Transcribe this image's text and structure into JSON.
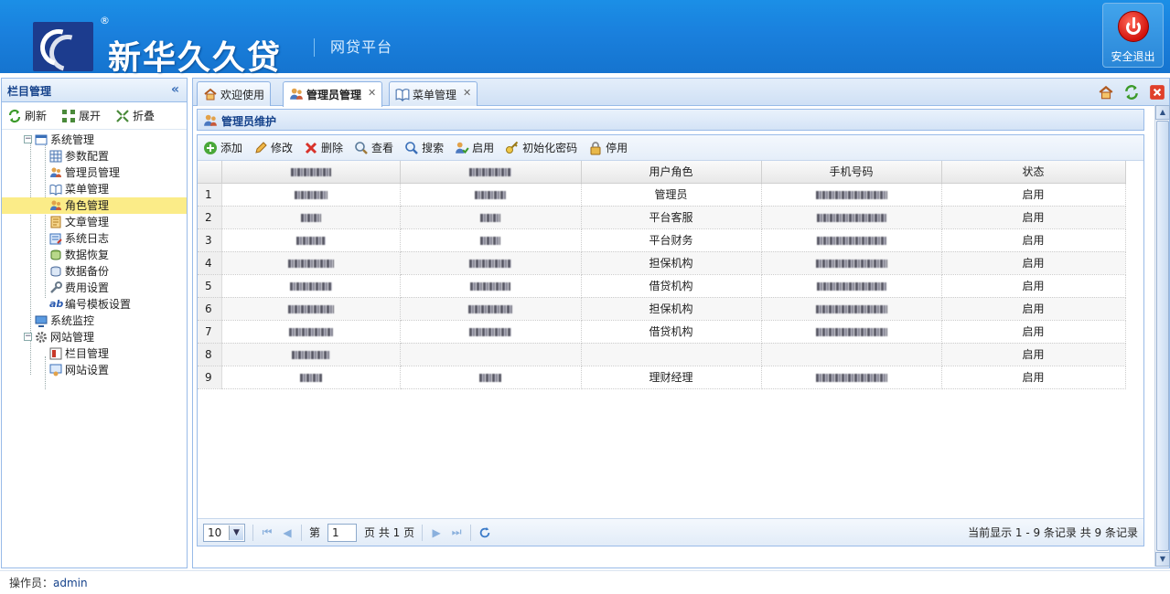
{
  "header": {
    "brand": "新华久久贷",
    "registered_mark": "®",
    "subtitle": "网贷平台",
    "logout_label": "安全退出"
  },
  "sidebar": {
    "title": "栏目管理",
    "toolbar": {
      "refresh": "刷新",
      "expand": "展开",
      "collapse": "折叠"
    },
    "tree": [
      {
        "label": "系统管理",
        "icon": "window-icon",
        "level": 0,
        "expanded": true
      },
      {
        "label": "参数配置",
        "icon": "grid-icon",
        "level": 1
      },
      {
        "label": "管理员管理",
        "icon": "users-icon",
        "level": 1
      },
      {
        "label": "菜单管理",
        "icon": "book-icon",
        "level": 1
      },
      {
        "label": "角色管理",
        "icon": "users-icon",
        "level": 1,
        "selected": true
      },
      {
        "label": "文章管理",
        "icon": "document-icon",
        "level": 1
      },
      {
        "label": "系统日志",
        "icon": "log-icon",
        "level": 1
      },
      {
        "label": "数据恢复",
        "icon": "restore-icon",
        "level": 1
      },
      {
        "label": "数据备份",
        "icon": "backup-icon",
        "level": 1
      },
      {
        "label": "费用设置",
        "icon": "wrench-icon",
        "level": 1
      },
      {
        "label": "编号模板设置",
        "icon": "ab-icon",
        "level": 1
      },
      {
        "label": "系统监控",
        "icon": "monitor-icon",
        "level": 0
      },
      {
        "label": "网站管理",
        "icon": "gear-icon",
        "level": 0,
        "expanded": true
      },
      {
        "label": "栏目管理",
        "icon": "columns-icon",
        "level": 1
      },
      {
        "label": "网站设置",
        "icon": "site-settings-icon",
        "level": 1
      }
    ]
  },
  "tabs": [
    {
      "label": "欢迎使用",
      "icon": "home-icon",
      "closable": false,
      "active": false
    },
    {
      "label": "管理员管理",
      "icon": "users-icon",
      "closable": true,
      "active": true
    },
    {
      "label": "菜单管理",
      "icon": "book-icon",
      "closable": true,
      "active": false
    }
  ],
  "tab_tools": [
    "home-icon",
    "refresh-icon",
    "close-icon"
  ],
  "panel": {
    "title": "管理员维护",
    "toolbar": [
      {
        "label": "添加",
        "icon": "add-icon"
      },
      {
        "label": "修改",
        "icon": "edit-icon"
      },
      {
        "label": "删除",
        "icon": "delete-icon"
      },
      {
        "label": "查看",
        "icon": "view-icon"
      },
      {
        "label": "搜索",
        "icon": "search-icon"
      },
      {
        "label": "启用",
        "icon": "enable-icon"
      },
      {
        "label": "初始化密码",
        "icon": "key-icon"
      },
      {
        "label": "停用",
        "icon": "lock-icon"
      }
    ],
    "columns": [
      "",
      "",
      "用户角色",
      "手机号码",
      "状态"
    ],
    "rows": [
      {
        "no": "1",
        "role": "管理员",
        "status": "启用"
      },
      {
        "no": "2",
        "role": "平台客服",
        "status": "启用"
      },
      {
        "no": "3",
        "role": "平台财务",
        "status": "启用"
      },
      {
        "no": "4",
        "role": "担保机构",
        "status": "启用"
      },
      {
        "no": "5",
        "role": "借贷机构",
        "status": "启用"
      },
      {
        "no": "6",
        "role": "担保机构",
        "status": "启用"
      },
      {
        "no": "7",
        "role": "借贷机构",
        "status": "启用"
      },
      {
        "no": "8",
        "role": "",
        "status": "启用"
      },
      {
        "no": "9",
        "role": "理财经理",
        "status": "启用"
      }
    ]
  },
  "pager": {
    "page_size": "10",
    "page_prefix": "第",
    "current_page": "1",
    "page_suffix": "页 共 1 页",
    "info": "当前显示 1 - 9 条记录 共 9 条记录"
  },
  "footer": {
    "operator_label": "操作员：",
    "operator": "admin"
  },
  "colors": {
    "header_blue": "#1a80dd",
    "border": "#99bbe8",
    "selected": "#fbec88",
    "title_text": "#15428b"
  }
}
